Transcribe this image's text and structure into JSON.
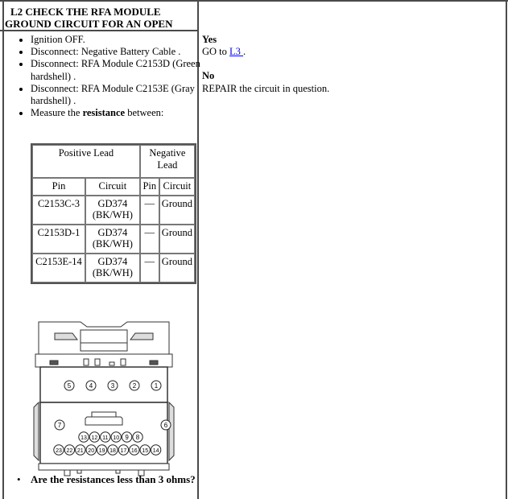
{
  "step": {
    "id": "L2",
    "title_line1": "L2 CHECK THE RFA MODULE",
    "title_line2": "GROUND CIRCUIT FOR AN OPEN"
  },
  "instructions": [
    {
      "text": "Ignition OFF."
    },
    {
      "text": "Disconnect: Negative Battery Cable ."
    },
    {
      "text": "Disconnect: RFA Module C2153D (Green hardshell) ."
    },
    {
      "text": "Disconnect: RFA Module C2153E (Gray hardshell) ."
    },
    {
      "prefix": "Measure the ",
      "bold": "resistance",
      "suffix": " between:"
    }
  ],
  "measurement_table": {
    "group_headers": [
      "Positive Lead",
      "Negative Lead"
    ],
    "column_headers": [
      "Pin",
      "Circuit",
      "Pin",
      "Circuit"
    ],
    "rows": [
      {
        "pos_pin": "C2153C-3",
        "pos_circuit": "GD374 (BK/WH)",
        "neg_pin": "—",
        "neg_circuit": "Ground"
      },
      {
        "pos_pin": "C2153D-1",
        "pos_circuit": "GD374 (BK/WH)",
        "neg_pin": "—",
        "neg_circuit": "Ground"
      },
      {
        "pos_pin": "C2153E-14",
        "pos_circuit": "GD374 (BK/WH)",
        "neg_pin": "—",
        "neg_circuit": "Ground"
      }
    ]
  },
  "connector_diagram": {
    "upper_pins": [
      "5",
      "4",
      "3",
      "2",
      "1"
    ],
    "side_pins": [
      "7",
      "6"
    ],
    "middle_row": [
      "13",
      "12",
      "11",
      "10",
      "9",
      "8"
    ],
    "bottom_row": [
      "23",
      "22",
      "21",
      "20",
      "19",
      "18",
      "17",
      "16",
      "15",
      "14"
    ]
  },
  "question": "Are the resistances less than 3 ohms?",
  "responses": {
    "yes_label": "Yes",
    "yes_prefix": "GO to ",
    "yes_link": "L3 ",
    "yes_suffix": ".",
    "no_label": "No",
    "no_text": "REPAIR the circuit in question."
  }
}
